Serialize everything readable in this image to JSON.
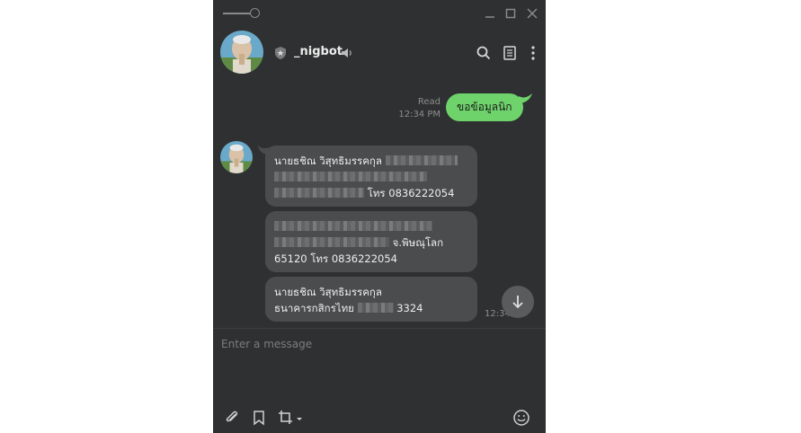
{
  "window": {
    "controls": {
      "minimize_icon": "minimize-icon",
      "maximize_icon": "maximize-icon",
      "close_icon": "close-icon"
    }
  },
  "header": {
    "contact_name": "_nigbot",
    "icons": [
      "shield-icon",
      "speaker-icon",
      "search-icon",
      "notes-icon",
      "more-vertical-icon"
    ]
  },
  "chat": {
    "outgoing": {
      "text": "ขอข้อมูลนิก",
      "status": "Read",
      "time": "12:34 PM"
    },
    "incoming": [
      {
        "line1": "นายธชิณ วิสุทธิมรรคกุล",
        "line3_suffix": "โทร 0836222054"
      },
      {
        "line2_suffix": "จ.พิษณุโลก",
        "line3": "65120 โทร 0836222054"
      },
      {
        "line1": "นายธชิณ วิสุทธิมรรคกุล",
        "line2_prefix": "ธนาคารกสิกรไทย",
        "line2_suffix": "3324"
      }
    ],
    "last_time": "12:34 PM"
  },
  "composer": {
    "placeholder": "Enter a message",
    "icons": [
      "attach-icon",
      "bookmark-icon",
      "crop-icon",
      "emoji-icon"
    ]
  },
  "colors": {
    "window_bg": "#2f3031",
    "outgoing_bubble": "#6fd36c",
    "incoming_bubble": "#4b4c4d"
  }
}
